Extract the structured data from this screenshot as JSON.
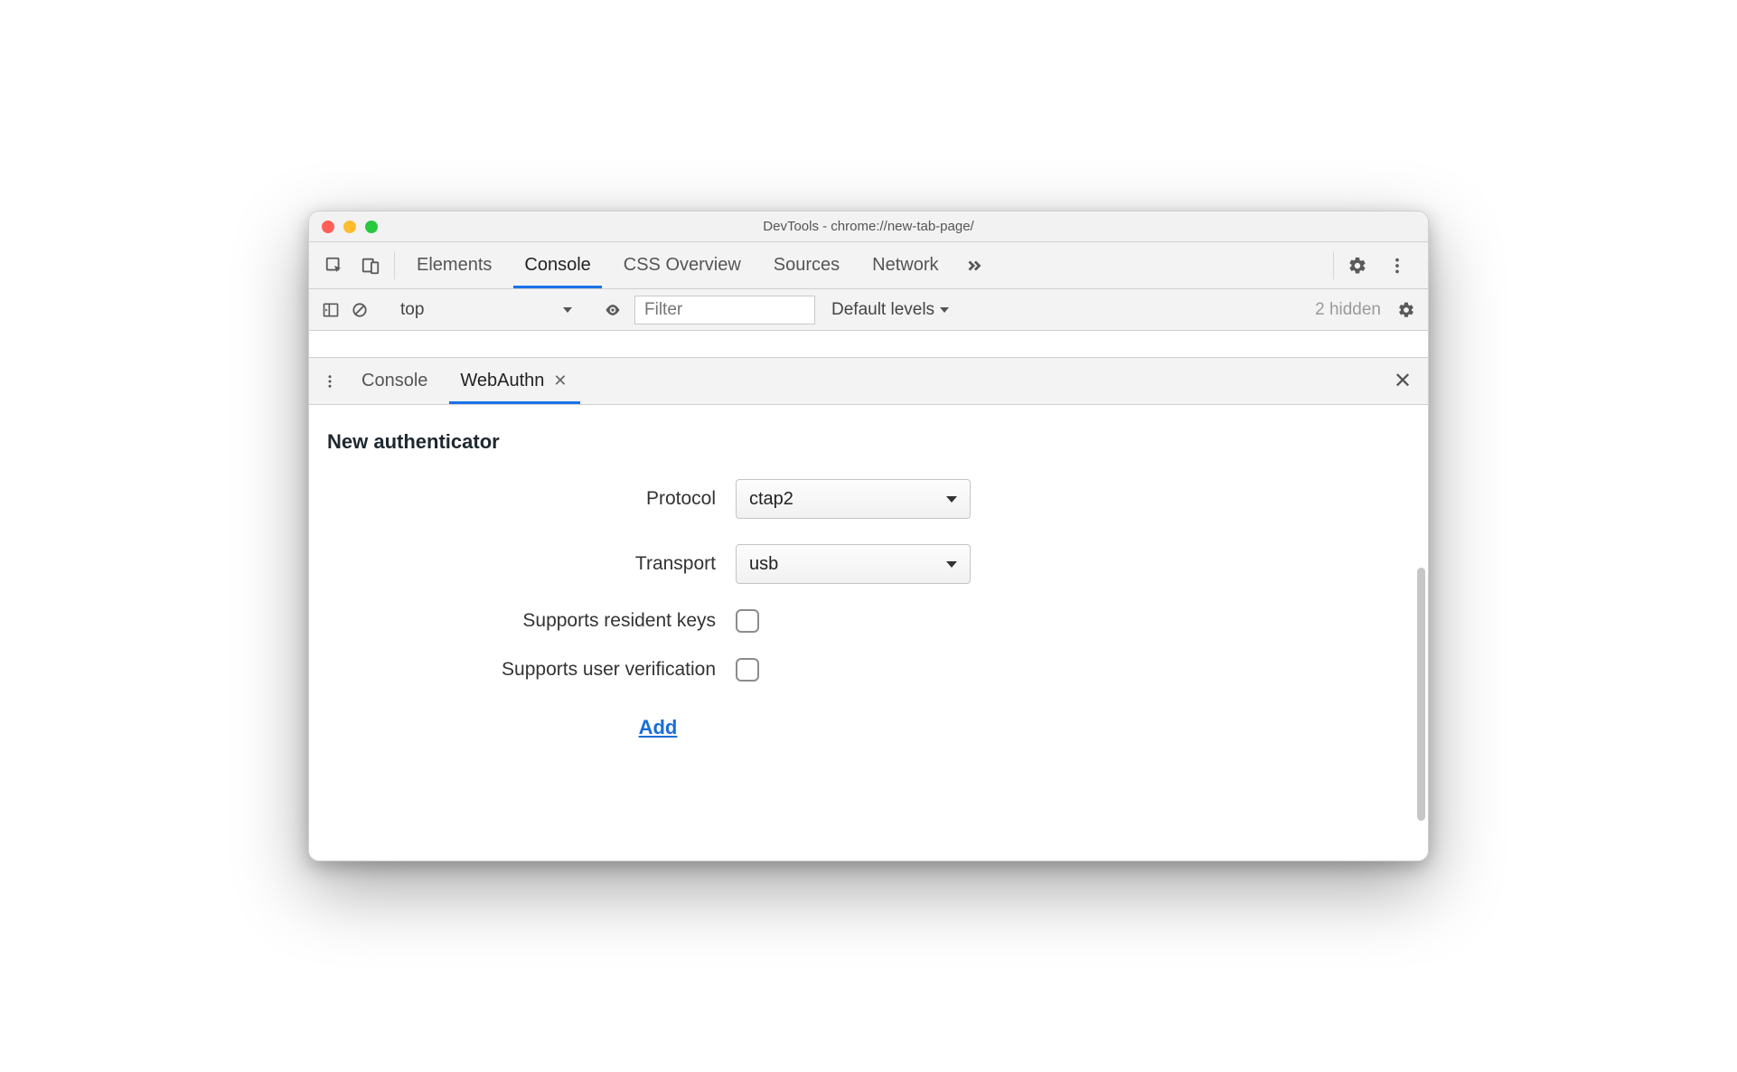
{
  "window": {
    "title": "DevTools - chrome://new-tab-page/"
  },
  "tabs": {
    "elements": "Elements",
    "console": "Console",
    "css_overview": "CSS Overview",
    "sources": "Sources",
    "network": "Network"
  },
  "console_bar": {
    "context": "top",
    "filter_placeholder": "Filter",
    "levels": "Default levels",
    "hidden": "2 hidden"
  },
  "drawer": {
    "console": "Console",
    "webauthn": "WebAuthn"
  },
  "webauthn": {
    "heading": "New authenticator",
    "labels": {
      "protocol": "Protocol",
      "transport": "Transport",
      "resident_keys": "Supports resident keys",
      "user_verification": "Supports user verification"
    },
    "values": {
      "protocol": "ctap2",
      "transport": "usb"
    },
    "add": "Add"
  }
}
